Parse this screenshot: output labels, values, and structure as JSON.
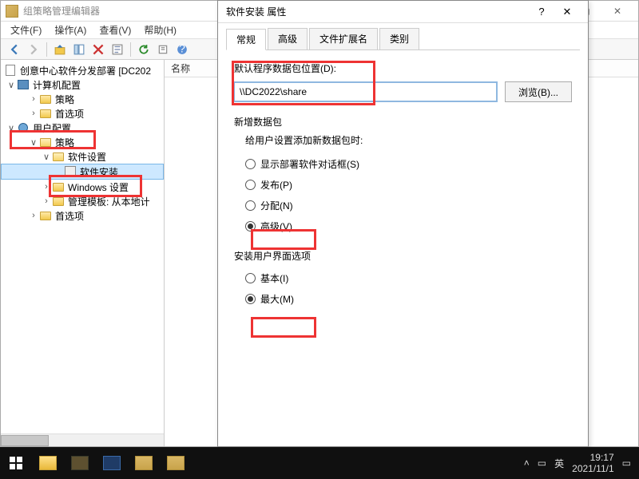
{
  "window": {
    "title": "组策略管理编辑器"
  },
  "menu": {
    "file": "文件(F)",
    "action": "操作(A)",
    "view": "查看(V)",
    "help": "帮助(H)"
  },
  "tree": {
    "root": "创意中心软件分发部署 [DC202",
    "computer_config": "计算机配置",
    "policies": "策略",
    "preferences": "首选项",
    "user_config": "用户配置",
    "policies2": "策略",
    "software_settings": "软件设置",
    "software_install": "软件安装",
    "windows_settings": "Windows 设置",
    "admin_templates": "管理模板: 从本地计",
    "preferences2": "首选项"
  },
  "list": {
    "col_name": "名称"
  },
  "dialog": {
    "title": "软件安装 属性",
    "tabs": {
      "general": "常规",
      "advanced": "高级",
      "file_ext": "文件扩展名",
      "category": "类别"
    },
    "default_pkg_loc_label": "默认程序数据包位置(D):",
    "default_pkg_loc_value": "\\\\DC2022\\share",
    "browse": "浏览(B)...",
    "new_pkg_group": "新增数据包",
    "when_add_label": "给用户设置添加新数据包时:",
    "opt_show_dialog": "显示部署软件对话框(S)",
    "opt_publish": "发布(P)",
    "opt_assign": "分配(N)",
    "opt_advanced": "高级(V)",
    "ui_group": "安装用户界面选项",
    "opt_basic": "基本(I)",
    "opt_max": "最大(M)"
  },
  "taskbar": {
    "ime": "英",
    "time": "19:17",
    "date": "2021/11/1"
  }
}
